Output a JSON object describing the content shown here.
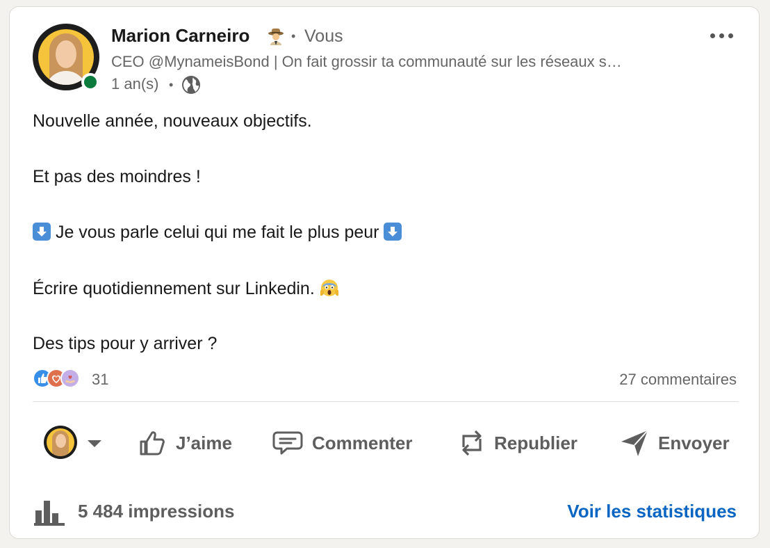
{
  "post": {
    "author": {
      "name": "Marion Carneiro",
      "name_emoji_icon": "spy-emoji-icon",
      "relation": "Vous",
      "headline": "CEO @MynameisBond | On fait grossir ta communauté sur les réseaux s…",
      "time": "1 an(s)",
      "visibility_icon": "globe-icon",
      "presence": "online",
      "presence_color": "#0a7a3d"
    },
    "text": {
      "line1": "Nouvelle année, nouveaux objectifs.",
      "line2": "Et pas des moindres !",
      "line3": "Je vous parle celui qui me fait le plus peur",
      "line4": "Écrire quotidiennement sur Linkedin.",
      "line5": "Des tips pour y arriver ?",
      "emojis": [
        "down-arrow-emoji-icon",
        "scream-emoji-icon"
      ]
    },
    "social": {
      "reactions_count": "31",
      "reaction_types": [
        "like",
        "love",
        "support"
      ],
      "comments": "27 commentaires"
    }
  },
  "actions": {
    "like": "J’aime",
    "comment": "Commenter",
    "repost": "Republier",
    "send": "Envoyer"
  },
  "footer": {
    "impressions": "5 484 impressions",
    "stats_link": "Voir les statistiques"
  },
  "colors": {
    "link": "#0a66c2",
    "text_muted": "#666666",
    "page_bg": "#f3f2ef"
  }
}
